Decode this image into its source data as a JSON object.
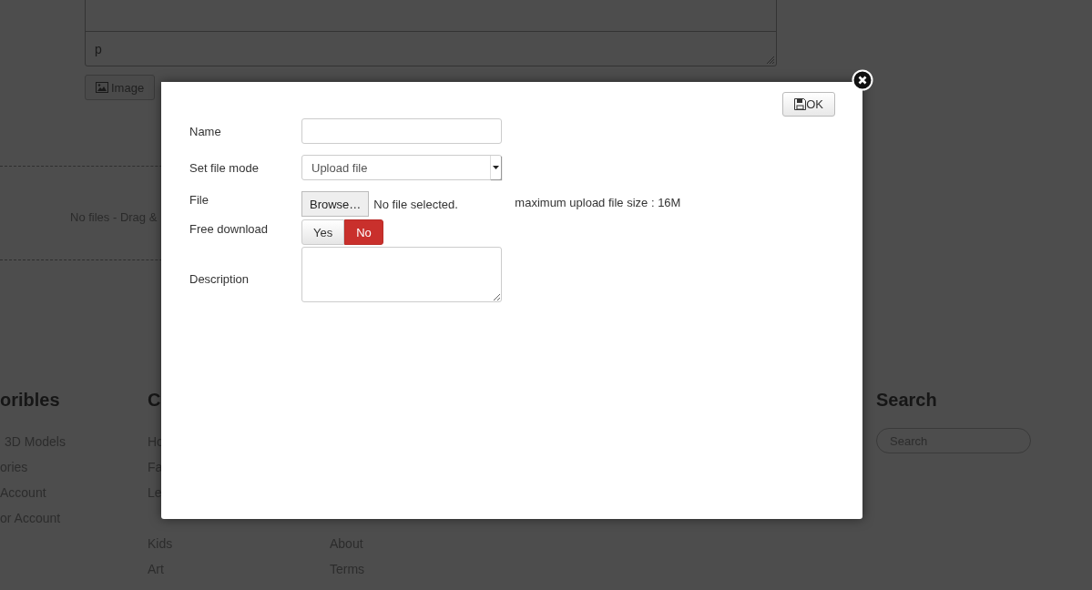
{
  "editor": {
    "text": "p"
  },
  "image_button": {
    "label": "Image"
  },
  "dropzone": {
    "text": "No files - Drag &"
  },
  "footer": {
    "columns": [
      {
        "heading": "oribles",
        "links": [
          "3D Models",
          "ories",
          "Account",
          "or Account"
        ]
      },
      {
        "heading": "C",
        "links": [
          "Ho",
          "Fa",
          "Le"
        ],
        "links_below": [
          "Kids",
          "Art"
        ]
      },
      {
        "links_below": [
          "About",
          "Terms"
        ]
      },
      {},
      {},
      {
        "heading": "Search",
        "search_placeholder": "Search"
      }
    ]
  },
  "dialog": {
    "ok_button": "OK",
    "fields": [
      {
        "kind": "text",
        "label": "Name"
      },
      {
        "kind": "select",
        "label": "Set file mode",
        "value": "Upload file"
      },
      {
        "kind": "file",
        "label": "File",
        "button": "Browse…",
        "status": "No file selected.",
        "note": "maximum upload file size : 16M"
      },
      {
        "kind": "toggle",
        "label": "Free download",
        "options": [
          {
            "label": "Yes",
            "selected": false
          },
          {
            "label": "No",
            "selected": true
          }
        ]
      },
      {
        "kind": "textarea",
        "label": "Description"
      }
    ]
  }
}
